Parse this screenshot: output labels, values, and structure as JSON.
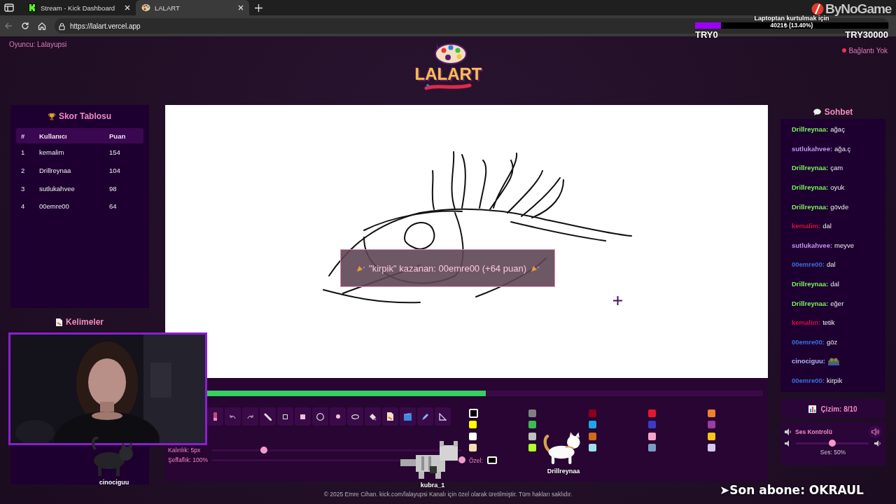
{
  "browser": {
    "tabs": [
      {
        "title": "Stream - Kick Dashboard",
        "selected": false,
        "kind": "kick"
      },
      {
        "title": "LALART",
        "selected": true,
        "kind": "palette"
      }
    ],
    "url": "https://lalart.vercel.app"
  },
  "overlay": {
    "brand": "ByNoGame",
    "goal": {
      "title": "Laptoptan kurtulmak için",
      "amount": "4021₺ (13.40%)",
      "level": 0.134,
      "min": "TRY0",
      "max": "TRY30000"
    },
    "pets": [
      {
        "name": "cinociguu",
        "kind": "black-cat"
      },
      {
        "name": "kubra_1",
        "kind": "pixel-cat"
      },
      {
        "name": "Drillreynaa",
        "kind": "white-cat"
      }
    ],
    "last_subscriber": "➤Son abone: OKRAUL"
  },
  "header": {
    "player": "Oyuncu: Lalayupsi",
    "logo": "LALART",
    "connection": {
      "label": "Bağlantı Yok",
      "connected": false
    }
  },
  "scoreboard": {
    "title": "Skor Tablosu",
    "columns": [
      "#",
      "Kullanıcı",
      "Puan"
    ],
    "rows": [
      [
        "1",
        "kemalim",
        "154"
      ],
      [
        "2",
        "Drillreynaa",
        "104"
      ],
      [
        "3",
        "sutlukahvee",
        "98"
      ],
      [
        "4",
        "00emre00",
        "64"
      ]
    ]
  },
  "words": {
    "title": "Kelimeler"
  },
  "canvas": {
    "toast": "\"kirpik\" kazanan: 00emre00 (+64 puan)",
    "timer": {
      "level": 0.536
    },
    "tools": [
      {
        "kind": "eraser"
      },
      {
        "kind": "undo"
      },
      {
        "kind": "redo"
      },
      {
        "kind": "line"
      },
      {
        "kind": "square"
      },
      {
        "kind": "filled-square"
      },
      {
        "kind": "circle"
      },
      {
        "kind": "dot"
      },
      {
        "kind": "ellipse"
      },
      {
        "kind": "bucket"
      },
      {
        "kind": "page"
      },
      {
        "kind": "cube"
      },
      {
        "kind": "pen"
      },
      {
        "kind": "triangle"
      }
    ],
    "colors": [
      {
        "color": "#000000",
        "selected": true
      },
      {
        "color": "#ffff00",
        "selected": false
      },
      {
        "color": "#ffffff",
        "selected": false
      },
      {
        "color": "#f5deb3",
        "selected": false
      },
      {
        "color": "#808080",
        "selected": false
      },
      {
        "color": "#3cba54",
        "selected": false
      },
      {
        "color": "#c0c0c0",
        "selected": false
      },
      {
        "color": "#adff2f",
        "selected": false
      },
      {
        "color": "#8b0018",
        "selected": false
      },
      {
        "color": "#1ea7e8",
        "selected": false
      },
      {
        "color": "#d2691e",
        "selected": false
      },
      {
        "color": "#a0e0e8",
        "selected": false
      },
      {
        "color": "#e5172f",
        "selected": false
      },
      {
        "color": "#3b3bc8",
        "selected": false
      },
      {
        "color": "#f4a6c8",
        "selected": false
      },
      {
        "color": "#7a9cc6",
        "selected": false
      },
      {
        "color": "#f08030",
        "selected": false
      },
      {
        "color": "#9b3ca0",
        "selected": false
      },
      {
        "color": "#f5c518",
        "selected": false
      },
      {
        "color": "#d8c8f0",
        "selected": false
      }
    ],
    "thickness": {
      "label": "Kalınlık: 5px",
      "level": 0.21
    },
    "opacity": {
      "label": "Şeffaflık: 100%",
      "level": 1
    },
    "custom": {
      "label": "Özel:",
      "color": "#000000"
    }
  },
  "chat": {
    "title": "Sohbet",
    "messages": [
      {
        "kind": "text",
        "user": "Drillreynaa:",
        "text": "ağaç",
        "color": "#7cf05a"
      },
      {
        "kind": "text",
        "user": "sutlukahvee:",
        "text": "ağa.ç",
        "color": "#c58ff0"
      },
      {
        "kind": "text",
        "user": "Drillreynaa:",
        "text": "çam",
        "color": "#7cf05a"
      },
      {
        "kind": "text",
        "user": "Drillreynaa:",
        "text": "oyuk",
        "color": "#7cf05a"
      },
      {
        "kind": "text",
        "user": "Drillreynaa:",
        "text": "gövde",
        "color": "#7cf05a"
      },
      {
        "kind": "text",
        "user": "kemalim:",
        "text": "dal",
        "color": "#d0103a"
      },
      {
        "kind": "text",
        "user": "sutlukahvee:",
        "text": "meyve",
        "color": "#c58ff0"
      },
      {
        "kind": "text",
        "user": "00emre00:",
        "text": "dal",
        "color": "#3a6fe0"
      },
      {
        "kind": "text",
        "user": "Drillreynaa:",
        "text": "dal",
        "color": "#7cf05a"
      },
      {
        "kind": "text",
        "user": "Drillreynaa:",
        "text": "eğer",
        "color": "#7cf05a"
      },
      {
        "kind": "text",
        "user": "kemalim:",
        "text": "tetik",
        "color": "#d0103a"
      },
      {
        "kind": "text",
        "user": "00emre00:",
        "text": "göz",
        "color": "#3a6fe0"
      },
      {
        "kind": "emote",
        "user": "cinociguu:",
        "color": "#b4b4f0"
      },
      {
        "kind": "text",
        "user": "00emre00:",
        "text": "kirpik",
        "color": "#3a6fe0"
      }
    ]
  },
  "round": "Çizim: 8/10",
  "sound": {
    "title": "Ses Kontrolü",
    "muted": false,
    "level": 0.5,
    "reading": "Ses: 50%"
  },
  "footer": "© 2025 Emre Cihan. kick.com/lalayupsi Kanalı için özel olarak üretilmiştir. Tüm hakları saklıdır."
}
